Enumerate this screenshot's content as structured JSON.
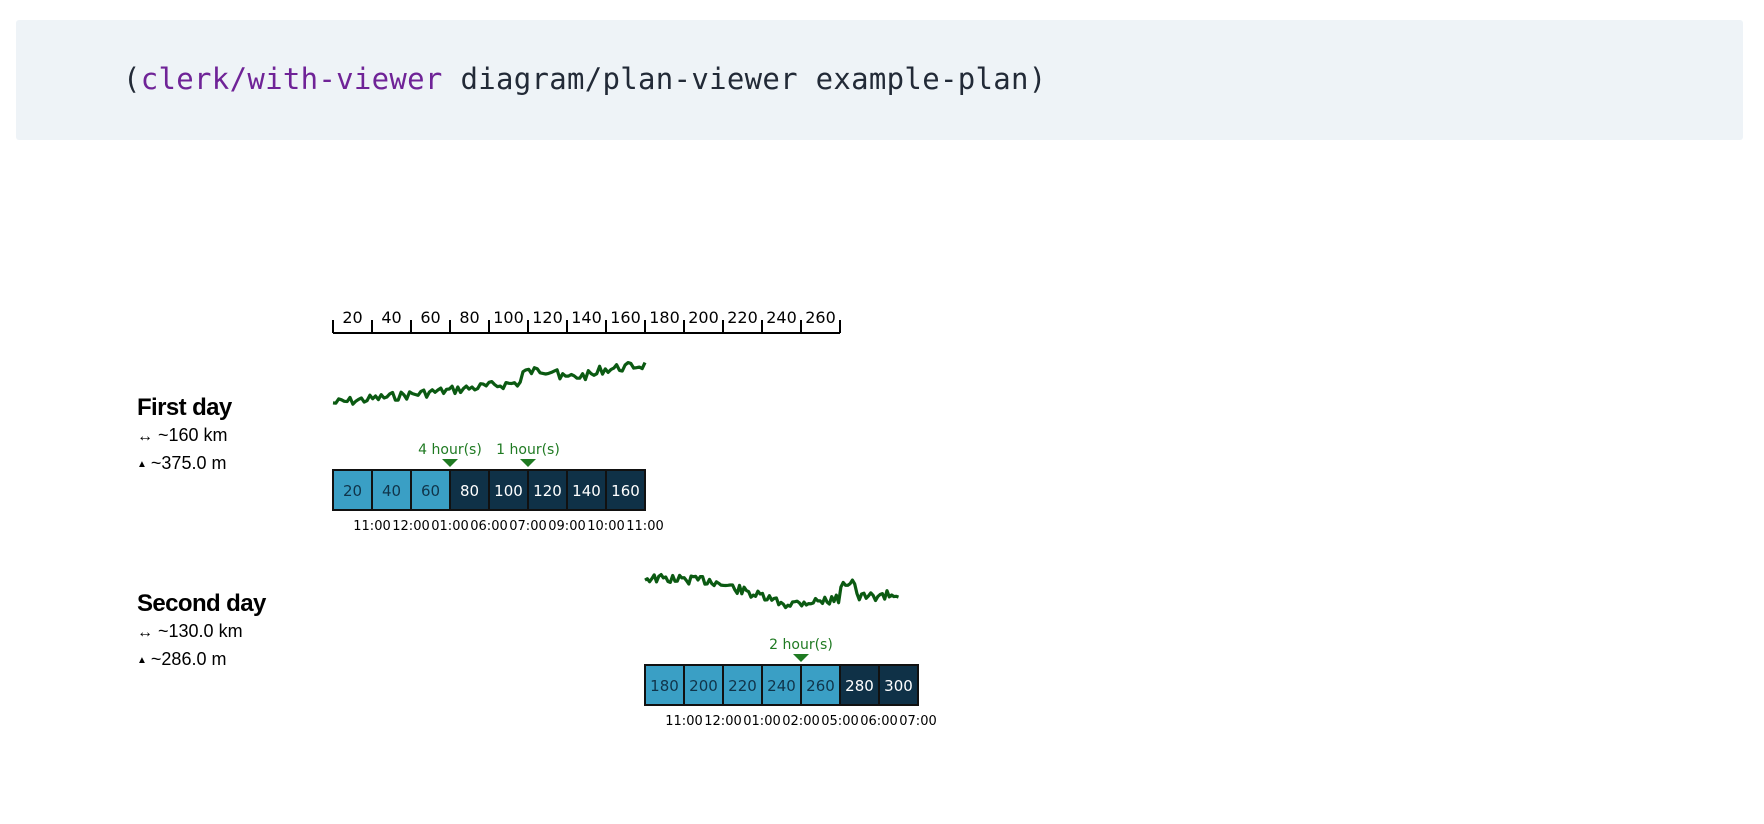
{
  "code": {
    "open_paren": "(",
    "fn_name": "clerk/with-viewer",
    "args": " diagram/plan-viewer example-plan)"
  },
  "scale": {
    "ticks": [
      "20",
      "40",
      "60",
      "80",
      "100",
      "120",
      "140",
      "160",
      "180",
      "200",
      "220",
      "240",
      "260"
    ]
  },
  "colors": {
    "elevation_line": "#0b5a12",
    "stop_marker": "#1f7a22",
    "segment_light": "#3a9fc5",
    "segment_dark": "#0f3147",
    "segment_border": "#111111"
  },
  "days": [
    {
      "title": "First day",
      "distance_icon": "↔",
      "distance": "~160 km",
      "ascent_icon": "▲",
      "ascent": "~375.0 m",
      "segments": [
        {
          "label": "20",
          "shade": "light"
        },
        {
          "label": "40",
          "shade": "light"
        },
        {
          "label": "60",
          "shade": "light"
        },
        {
          "label": "80",
          "shade": "dark"
        },
        {
          "label": "100",
          "shade": "dark"
        },
        {
          "label": "120",
          "shade": "dark"
        },
        {
          "label": "140",
          "shade": "dark"
        },
        {
          "label": "160",
          "shade": "dark"
        }
      ],
      "times": [
        "11:00",
        "12:00",
        "01:00",
        "06:00",
        "07:00",
        "09:00",
        "10:00",
        "11:00"
      ],
      "stops": [
        {
          "at_km": 60,
          "label": "4 hour(s)"
        },
        {
          "at_km": 100,
          "label": "1 hour(s)"
        }
      ]
    },
    {
      "title": "Second day",
      "distance_icon": "↔",
      "distance": "~130.0 km",
      "ascent_icon": "▲",
      "ascent": "~286.0 m",
      "segments": [
        {
          "label": "180",
          "shade": "light"
        },
        {
          "label": "200",
          "shade": "light"
        },
        {
          "label": "220",
          "shade": "light"
        },
        {
          "label": "240",
          "shade": "light"
        },
        {
          "label": "260",
          "shade": "light"
        },
        {
          "label": "280",
          "shade": "dark"
        },
        {
          "label": "300",
          "shade": "dark"
        }
      ],
      "times": [
        "11:00",
        "12:00",
        "01:00",
        "02:00",
        "05:00",
        "06:00",
        "07:00"
      ],
      "stops": [
        {
          "at_km": 240,
          "label": "2 hour(s)"
        }
      ]
    }
  ]
}
